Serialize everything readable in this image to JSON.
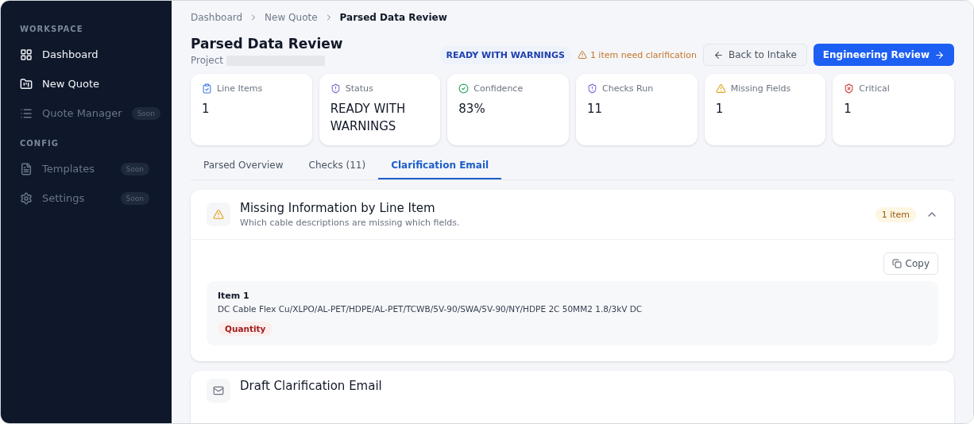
{
  "sidebar": {
    "sections": [
      {
        "title": "WORKSPACE",
        "items": [
          {
            "label": "Dashboard",
            "kind": "grid",
            "disabled": false
          },
          {
            "label": "New Quote",
            "kind": "folder",
            "disabled": false
          },
          {
            "label": "Quote Manager",
            "kind": "list",
            "disabled": true,
            "badge": "Soon"
          }
        ]
      },
      {
        "title": "CONFIG",
        "items": [
          {
            "label": "Templates",
            "kind": "file",
            "disabled": true,
            "badge": "Soon"
          },
          {
            "label": "Settings",
            "kind": "gear",
            "disabled": true,
            "badge": "Soon"
          }
        ]
      }
    ]
  },
  "breadcrumb": [
    "Dashboard",
    "New Quote",
    "Parsed Data Review"
  ],
  "header": {
    "title": "Parsed Data Review",
    "project_label": "Project",
    "status_badge": "READY WITH WARNINGS",
    "warning": "1 item need clarification",
    "back_button": "Back to Intake",
    "primary_button": "Engineering Review"
  },
  "stats": [
    {
      "kind": "line_items",
      "label": "Line Items",
      "value": "1"
    },
    {
      "kind": "status",
      "label": "Status",
      "value": "READY WITH WARNINGS"
    },
    {
      "kind": "confidence",
      "label": "Confidence",
      "value": "83%"
    },
    {
      "kind": "checks",
      "label": "Checks Run",
      "value": "11"
    },
    {
      "kind": "missing",
      "label": "Missing Fields",
      "value": "1"
    },
    {
      "kind": "critical",
      "label": "Critical",
      "value": "1"
    }
  ],
  "tabs": [
    {
      "label": "Parsed Overview",
      "selected": false
    },
    {
      "label": "Checks (11)",
      "selected": false
    },
    {
      "label": "Clarification Email",
      "selected": true
    }
  ],
  "missing_panel": {
    "title": "Missing Information by Line Item",
    "subtitle": "Which cable descriptions are missing which fields.",
    "count_badge": "1 item",
    "expanded": true,
    "copy_button": "Copy",
    "items": [
      {
        "title": "Item 1",
        "description": "DC Cable Flex Cu/XLPO/AL-PET/HDPE/AL-PET/TCWB/5V-90/SWA/5V-90/NY/HDPE 2C 50MM2 1.8/3kV DC",
        "missing": [
          "Quantity"
        ]
      }
    ]
  },
  "draft_panel": {
    "title": "Draft Clarification Email"
  }
}
